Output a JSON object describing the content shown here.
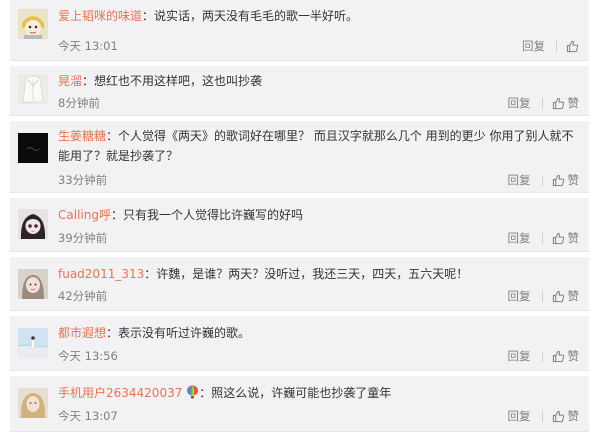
{
  "actions": {
    "reply_label": "回复",
    "like_label": "赞"
  },
  "colors": {
    "username": "#eb7350",
    "background": "#f2f2f5",
    "meta": "#808080",
    "text": "#333333"
  },
  "comments": [
    {
      "username": "爱上韬咪的味道",
      "separator": "：",
      "text": "说实话，两天没有毛毛的歌一半好听。",
      "time": "今天 13:01",
      "show_like_label": false,
      "avatar_icon": "cartoon-face-avatar-icon"
    },
    {
      "username": "晃溜",
      "separator": "：",
      "text": "想红也不用这样吧，这也叫抄袭",
      "time": "8分钟前",
      "show_like_label": true,
      "avatar_icon": "white-coat-avatar-icon"
    },
    {
      "username": "生姜糖糖",
      "separator": "：",
      "text": "个人觉得《两天》的歌词好在哪里？ 而且汉字就那么几个 用到的更少 你用了别人就不能用了？就是抄袭了？",
      "time": "33分钟前",
      "show_like_label": true,
      "avatar_icon": "dark-avatar-icon"
    },
    {
      "username": "Calling呼",
      "separator": "：",
      "text": "只有我一个人觉得比许巍写的好吗",
      "time": "39分钟前",
      "show_like_label": true,
      "avatar_icon": "anime-girl-avatar-icon"
    },
    {
      "username": "fuad2011_313",
      "separator": "：",
      "text": "许魏，是谁？两天？没听过，我还三天，四天，五六天呢！",
      "time": "42分钟前",
      "show_like_label": true,
      "avatar_icon": "portrait-avatar-icon"
    },
    {
      "username": "都市遐想",
      "separator": "：",
      "text": "表示没有听过许巍的歌。",
      "time": "今天 13:56",
      "show_like_label": true,
      "avatar_icon": "seaside-avatar-icon"
    },
    {
      "username": "手机用户2634420037",
      "separator": "：",
      "text": "照这么说，许巍可能也抄袭了童年",
      "time": "今天 13:07",
      "show_like_label": true,
      "avatar_icon": "blonde-avatar-icon",
      "badge_icon": "hot-air-balloon-icon"
    }
  ]
}
